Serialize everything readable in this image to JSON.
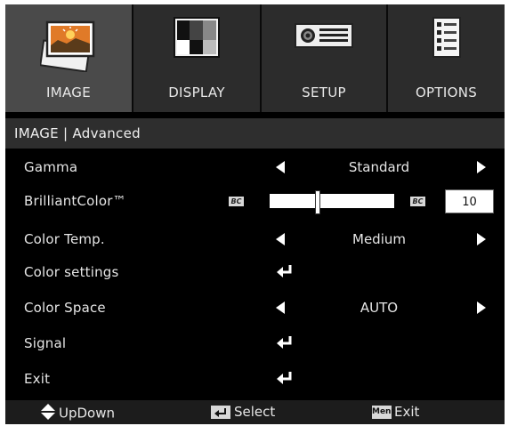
{
  "tabs": [
    {
      "label": "IMAGE",
      "icon": "picture-icon",
      "active": true
    },
    {
      "label": "DISPLAY",
      "icon": "display-pattern-icon",
      "active": false
    },
    {
      "label": "SETUP",
      "icon": "projector-icon",
      "active": false
    },
    {
      "label": "OPTIONS",
      "icon": "checklist-icon",
      "active": false
    }
  ],
  "breadcrumb": "IMAGE | Advanced",
  "rows": {
    "gamma": {
      "label": "Gamma",
      "value": "Standard"
    },
    "brilliant": {
      "label": "BrilliantColor™",
      "value": "10",
      "level_percent": 38,
      "bc_label": "BC"
    },
    "color_temp": {
      "label": "Color Temp.",
      "value": "Medium"
    },
    "color_settings": {
      "label": "Color settings"
    },
    "color_space": {
      "label": "Color Space",
      "value": "AUTO"
    },
    "signal": {
      "label": "Signal"
    },
    "exit": {
      "label": "Exit"
    }
  },
  "footer": {
    "updown": "UpDown",
    "select": "Select",
    "menu_key": "Menu",
    "exit": "Exit"
  },
  "colors": {
    "osd_bg": "#000000",
    "tab_active": "#4a4a4a",
    "tab_bg": "#2c2c2c",
    "text": "#e6e6e6"
  }
}
